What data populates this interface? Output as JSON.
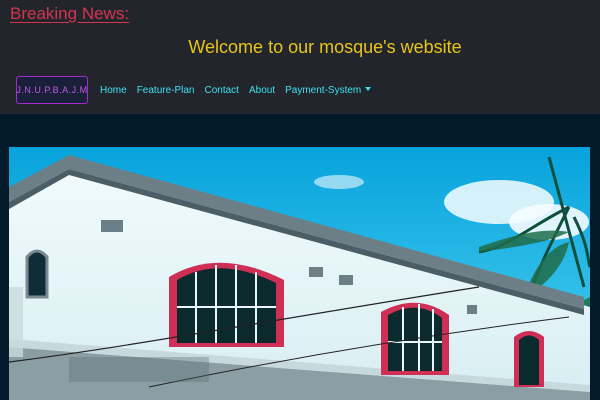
{
  "breaking_news": {
    "label": "Breaking News:"
  },
  "welcome": {
    "text": "Welcome to our mosque's website"
  },
  "navbar": {
    "brand": "J.N.U.P.B.A.J.M",
    "links": [
      {
        "label": "Home"
      },
      {
        "label": "Feature-Plan"
      },
      {
        "label": "Contact"
      },
      {
        "label": "About"
      },
      {
        "label": "Payment-System",
        "has_dropdown": true
      }
    ]
  },
  "colors": {
    "header_bg": "#22262c",
    "page_bg": "#031a2b",
    "breaking_news": "#d6334d",
    "welcome_text": "#e8c51a",
    "nav_link": "#3fe0f2",
    "brand_border": "#a52bd0"
  }
}
